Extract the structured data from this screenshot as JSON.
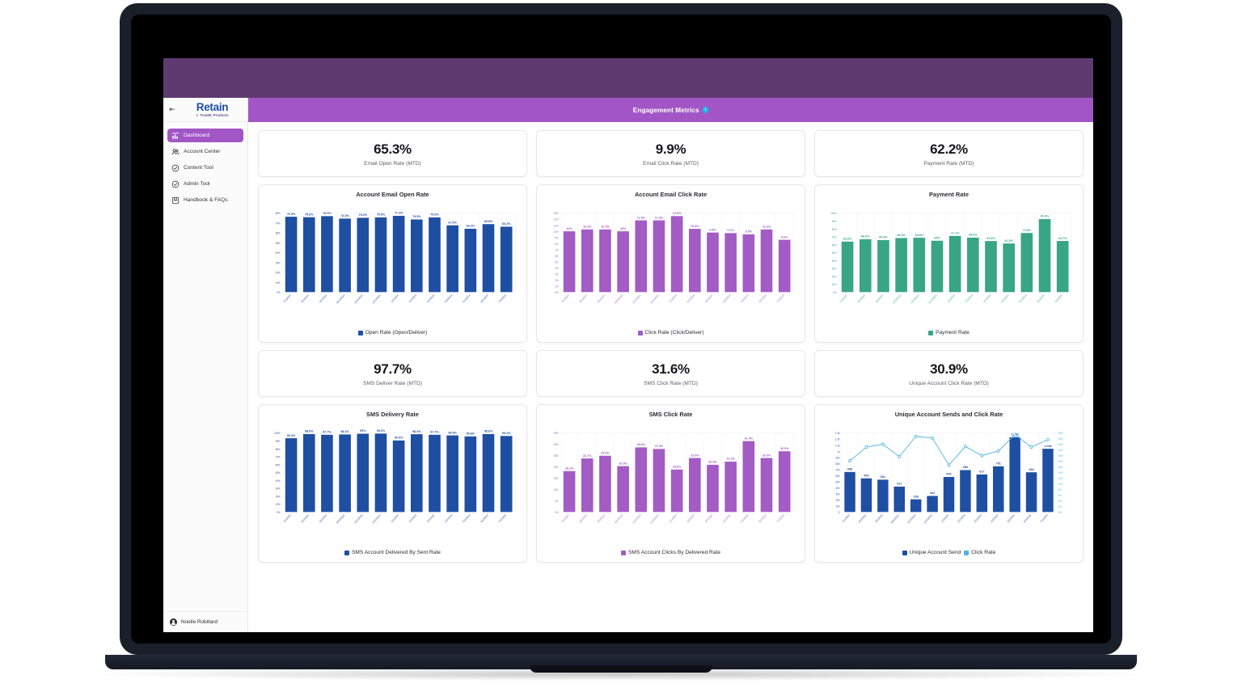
{
  "window": {
    "top_band_color": "#5f3a70",
    "frame_color": "#1b1f2a"
  },
  "sidebar": {
    "collapse_icon": "collapse-left-icon",
    "logo": {
      "name": "Retain",
      "tagline": "TrueML Products"
    },
    "items": [
      {
        "label": "Dashboard",
        "icon": "bar-chart-icon",
        "active": true
      },
      {
        "label": "Account Center",
        "icon": "users-icon",
        "active": false
      },
      {
        "label": "Content Tool",
        "icon": "check-circle-icon",
        "active": false
      },
      {
        "label": "Admin Tool",
        "icon": "check-circle-icon",
        "active": false
      },
      {
        "label": "Handbook & FAQs",
        "icon": "book-icon",
        "active": false
      }
    ],
    "user": {
      "name": "Noelle Robillard",
      "icon": "avatar-icon"
    },
    "active_color": "#a256c6"
  },
  "header": {
    "title": "Engagement Metrics",
    "info_icon": "info-icon",
    "bar_color": "#a256c6"
  },
  "kpis_row1": [
    {
      "value": "65.3%",
      "label": "Email Open Rate (MTD)"
    },
    {
      "value": "9.9%",
      "label": "Email Click Rate (MTD)"
    },
    {
      "value": "62.2%",
      "label": "Payment Rate (MTD)"
    }
  ],
  "kpis_row2": [
    {
      "value": "97.7%",
      "label": "SMS Deliver Rate (MTD)"
    },
    {
      "value": "31.6%",
      "label": "SMS Click Rate (MTD)"
    },
    {
      "value": "30.9%",
      "label": "Unique Account Click Rate (MTD)"
    }
  ],
  "colors": {
    "blue": "#1f4fa3",
    "purple": "#a25cc4",
    "green": "#38a684",
    "light_blue": "#4eb3e6",
    "grid": "#e9edf3"
  },
  "chart_data": [
    {
      "id": "account-email-open-rate",
      "type": "bar",
      "title": "Account Email Open Rate",
      "color": "#1f4fa3",
      "legend": [
        {
          "name": "Open Rate (Open/Deliver)",
          "color": "#1f4fa3"
        }
      ],
      "categories": [
        "7/1/2023",
        "8/1/2023",
        "9/1/2023",
        "10/1/2023",
        "11/1/2023",
        "12/1/2023",
        "1/1/2024",
        "2/1/2024",
        "3/1/2024",
        "4/1/2024",
        "5/1/2024",
        "6/1/2024",
        "7/1/2024"
      ],
      "values": [
        76.3,
        75.8,
        76.9,
        74.4,
        75.2,
        75.6,
        77.2,
        73.5,
        75.6,
        67.6,
        64.1,
        68.8,
        66.2
      ],
      "labels": [
        "76.3%",
        "75.8%",
        "76.9%",
        "74.4%",
        "75.2%",
        "75.6%",
        "77.2%",
        "73.5%",
        "75.6%",
        "67.6%",
        "64.1%",
        "68.8%",
        "66.2%"
      ],
      "yticks": [
        "0%",
        "10%",
        "20%",
        "30%",
        "40%",
        "50%",
        "60%",
        "70%",
        "80%"
      ],
      "ylim": [
        0,
        80
      ],
      "xlabel": "",
      "ylabel": "",
      "grid": true
    },
    {
      "id": "account-email-click-rate",
      "type": "bar",
      "title": "Account Email Click Rate",
      "color": "#a25cc4",
      "legend": [
        {
          "name": "Click Rate (Click/Deliver)",
          "color": "#a25cc4"
        }
      ],
      "categories": [
        "7/1/2023",
        "8/1/2023",
        "9/1/2023",
        "10/1/2023",
        "11/1/2023",
        "12/1/2023",
        "1/1/2024",
        "2/1/2024",
        "3/1/2024",
        "4/1/2024",
        "5/1/2024",
        "6/1/2024",
        "7/1/2024"
      ],
      "values": [
        10,
        10.3,
        10.3,
        10,
        11.8,
        11.8,
        12.5,
        10.4,
        9.8,
        9.7,
        9.5,
        10.3,
        8.6
      ],
      "labels": [
        "10%",
        "10.3%",
        "10.3%",
        "10%",
        "11.8%",
        "11.8%",
        "12.5%",
        "10.4%",
        "9.8%",
        "9.7%",
        "9.5%",
        "10.3%",
        "8.6%"
      ],
      "yticks": [
        "0%",
        "1%",
        "2%",
        "3%",
        "4%",
        "5%",
        "6%",
        "7%",
        "8%",
        "9%",
        "10%",
        "11%",
        "12%",
        "13%"
      ],
      "ylim": [
        0,
        13
      ],
      "xlabel": "",
      "ylabel": "",
      "grid": true
    },
    {
      "id": "payment-rate",
      "type": "bar",
      "title": "Payment Rate",
      "color": "#38a684",
      "legend": [
        {
          "name": "Payment Rate",
          "color": "#38a684"
        }
      ],
      "categories": [
        "7/1/2023",
        "8/1/2023",
        "9/1/2023",
        "10/1/2023",
        "11/1/2023",
        "12/1/2023",
        "1/1/2024",
        "2/1/2024",
        "3/1/2024",
        "4/1/2024",
        "5/1/2024",
        "6/1/2024",
        "7/1/2024"
      ],
      "values": [
        63.9,
        66.8,
        65.8,
        68.4,
        68.8,
        65,
        71.1,
        68.9,
        64.6,
        61.5,
        74.8,
        92.4,
        64.7
      ],
      "labels": [
        "63.9%",
        "66.8%",
        "65.8%",
        "68.4%",
        "68.8%",
        "65%",
        "71.1%",
        "68.9%",
        "64.6%",
        "61.5%",
        "74.8%",
        "92.4%",
        "64.7%"
      ],
      "yticks": [
        "0%",
        "10%",
        "20%",
        "30%",
        "40%",
        "50%",
        "60%",
        "70%",
        "80%",
        "90%",
        "100%"
      ],
      "ylim": [
        0,
        100
      ],
      "xlabel": "",
      "ylabel": "",
      "grid": true
    },
    {
      "id": "sms-delivery-rate",
      "type": "bar",
      "title": "SMS Delivery Rate",
      "color": "#1f4fa3",
      "legend": [
        {
          "name": "SMS Account Delivered By Sent Rate",
          "color": "#1f4fa3"
        }
      ],
      "categories": [
        "7/1/2023",
        "8/1/2023",
        "9/1/2023",
        "10/1/2023",
        "11/1/2023",
        "12/1/2023",
        "1/1/2024",
        "2/1/2024",
        "3/1/2024",
        "4/1/2024",
        "5/1/2024",
        "6/1/2024",
        "7/1/2024"
      ],
      "values": [
        93.3,
        98.6,
        97.7,
        98.1,
        99,
        99.2,
        90.5,
        98.4,
        97.7,
        96.9,
        95.6,
        98.6,
        96.2
      ],
      "labels": [
        "93.3%",
        "98.6%",
        "97.7%",
        "98.1%",
        "99%",
        "99.2%",
        "90.5%",
        "98.4%",
        "97.7%",
        "96.9%",
        "95.6%",
        "98.6%",
        "96.2%"
      ],
      "yticks": [
        "0%",
        "10%",
        "20%",
        "30%",
        "40%",
        "50%",
        "60%",
        "70%",
        "80%",
        "90%",
        "100%"
      ],
      "ylim": [
        0,
        100
      ],
      "xlabel": "",
      "ylabel": "",
      "grid": true
    },
    {
      "id": "sms-click-rate",
      "type": "bar",
      "title": "SMS Click Rate",
      "color": "#a25cc4",
      "legend": [
        {
          "name": "SMS Account Clicks By Delivered Rate",
          "color": "#a25cc4"
        }
      ],
      "categories": [
        "7/1/2023",
        "8/1/2023",
        "9/1/2023",
        "10/1/2023",
        "11/1/2023",
        "12/1/2023",
        "1/1/2024",
        "2/1/2024",
        "3/1/2024",
        "4/1/2024",
        "5/1/2024",
        "6/1/2024",
        "7/1/2024"
      ],
      "values": [
        18.1,
        23.7,
        24.9,
        20.3,
        28.6,
        27.9,
        18.8,
        23.9,
        20.9,
        22.3,
        31.4,
        23.9,
        26.9
      ],
      "labels": [
        "18.1%",
        "23.7%",
        "24.9%",
        "20.3%",
        "28.6%",
        "27.9%",
        "18.8%",
        "23.9%",
        "20.9%",
        "22.3%",
        "31.4%",
        "23.9%",
        "26.9%"
      ],
      "yticks": [
        "0%",
        "5%",
        "10%",
        "15%",
        "20%",
        "25%",
        "30%",
        "35%"
      ],
      "ylim": [
        0,
        35
      ],
      "xlabel": "",
      "ylabel": "",
      "grid": true
    },
    {
      "id": "unique-account-sends-and-click-rate",
      "type": "bar+line",
      "title": "Unique Account Sends and Click Rate",
      "legend": [
        {
          "name": "Unique Account Send",
          "color": "#1f4fa3"
        },
        {
          "name": "Click Rate",
          "color": "#4eb3e6"
        }
      ],
      "categories": [
        "7/1/2023",
        "8/1/2023",
        "9/1/2023",
        "10/1/2023",
        "11/1/2023",
        "12/1/2023",
        "1/1/2024",
        "2/1/2024",
        "3/1/2024",
        "4/1/2024",
        "5/1/2024",
        "6/1/2024",
        "7/1/2024"
      ],
      "series": [
        {
          "name": "Unique Account Send",
          "type": "bar",
          "color": "#1f4fa3",
          "axis": "left",
          "values": [
            658,
            553,
            531,
            417,
            208,
            264,
            576,
            689,
            617,
            751,
            1230,
            653,
            1040
          ],
          "labels": [
            "658",
            "553",
            "531",
            "417",
            "208",
            "264",
            "576",
            "689",
            "617",
            "751",
            "1.23k",
            "653",
            "1.04k"
          ]
        },
        {
          "name": "Click Rate",
          "type": "line",
          "color": "#4eb3e6",
          "axis": "right",
          "values": [
            18.1,
            23.0,
            24.0,
            19.6,
            26.8,
            26.2,
            16.6,
            23.2,
            20.0,
            21.6,
            27.4,
            23.0,
            25.6
          ]
        }
      ],
      "yticks_left": [
        "0",
        "100",
        "200",
        "300",
        "400",
        "500",
        "600",
        "700",
        "800",
        "900",
        "1k",
        "1.1k",
        "1.2k",
        "1.3k"
      ],
      "ylim_left": [
        0,
        1300
      ],
      "yticks_right": [
        "0%",
        "2%",
        "4%",
        "6%",
        "8%",
        "10%",
        "12%",
        "14%",
        "16%",
        "18%",
        "20%",
        "22%",
        "24%",
        "26%",
        "28%"
      ],
      "ylim_right": [
        0,
        28
      ],
      "xlabel": "",
      "ylabel": "",
      "grid": true
    }
  ]
}
